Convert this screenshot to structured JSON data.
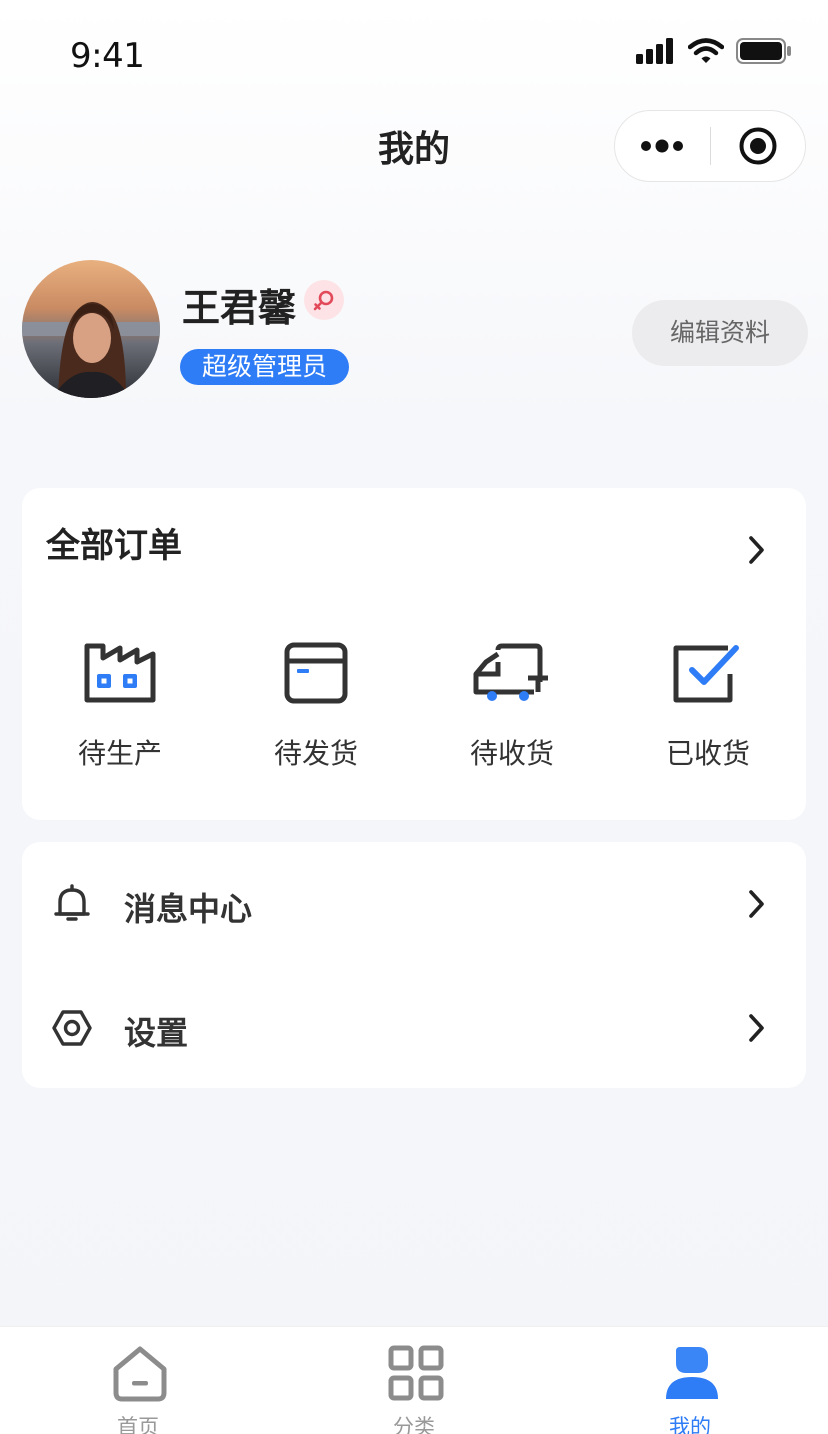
{
  "status_bar": {
    "time": "9:41"
  },
  "nav": {
    "title": "我的",
    "more_icon": "more-dots-icon",
    "close_icon": "target-icon"
  },
  "profile": {
    "name": "王君馨",
    "gender_icon": "female-icon",
    "role": "超级管理员",
    "edit_label": "编辑资料"
  },
  "orders": {
    "title": "全部订单",
    "items": [
      {
        "label": "待生产",
        "icon": "factory-icon"
      },
      {
        "label": "待发货",
        "icon": "box-icon"
      },
      {
        "label": "待收货",
        "icon": "truck-icon"
      },
      {
        "label": "已收货",
        "icon": "check-square-icon"
      }
    ]
  },
  "menu": {
    "items": [
      {
        "label": "消息中心",
        "icon": "bell-icon"
      },
      {
        "label": "设置",
        "icon": "settings-hex-icon"
      }
    ]
  },
  "tabbar": {
    "items": [
      {
        "label": "首页",
        "icon": "home-icon"
      },
      {
        "label": "分类",
        "icon": "grid-icon"
      },
      {
        "label": "我的",
        "icon": "user-icon",
        "active": true
      }
    ]
  },
  "colors": {
    "accent": "#2e7cf6",
    "text": "#222222",
    "muted": "#999999"
  }
}
